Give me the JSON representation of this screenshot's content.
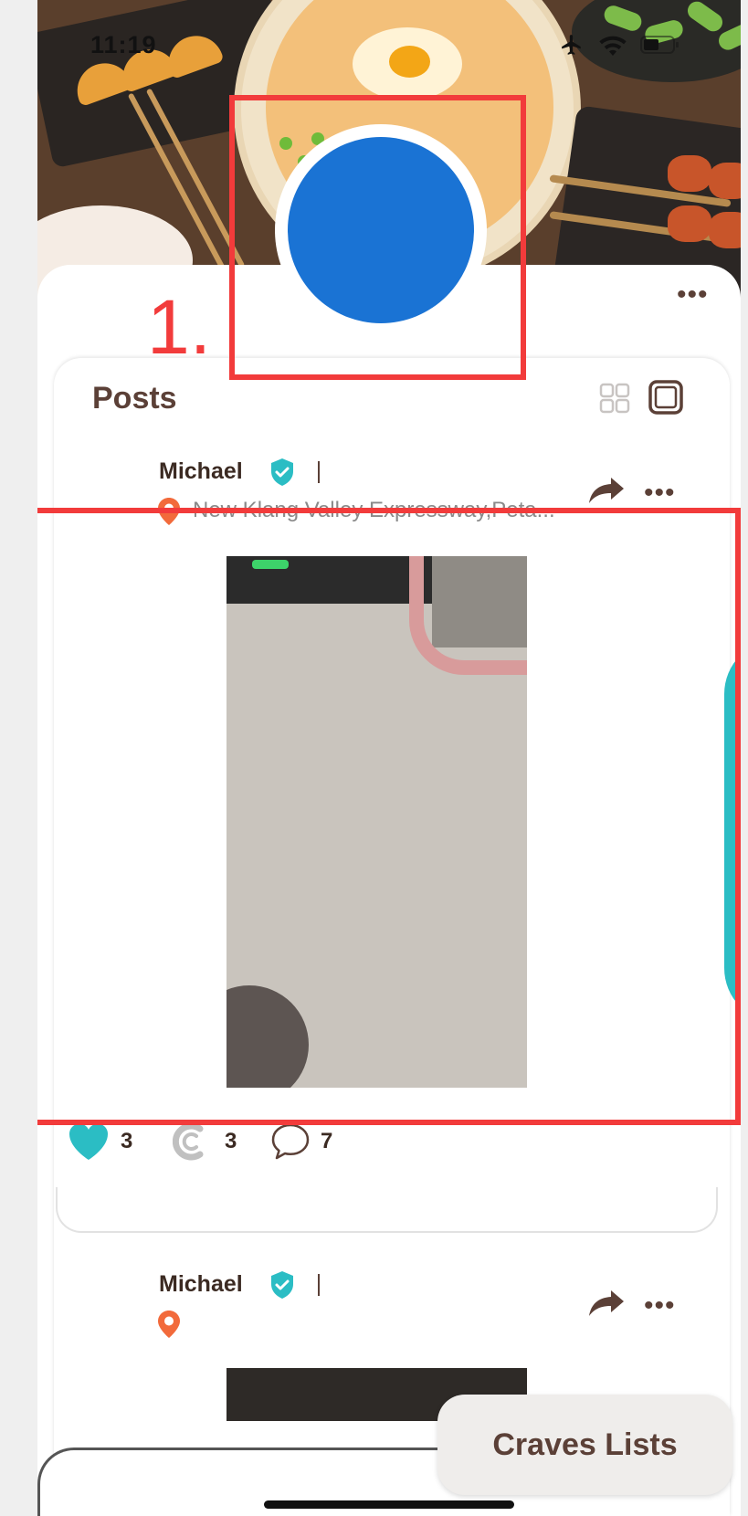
{
  "status_bar": {
    "time": "11:19",
    "icons": [
      "airplane-icon",
      "wifi-icon",
      "battery-icon"
    ]
  },
  "annotation": {
    "label": "1.",
    "color": "#f23b3b"
  },
  "profile": {
    "avatar_color": "#1a73d4",
    "more_icon": "more-icon"
  },
  "posts_section": {
    "title": "Posts",
    "view_icons": [
      "grid-view-icon",
      "single-view-icon"
    ]
  },
  "posts": [
    {
      "author": "Michael",
      "location": "New Klang Valley Expressway,Peta...",
      "likes": "3",
      "craves": "3",
      "comments": "7"
    },
    {
      "author": "Michael",
      "location": ""
    }
  ],
  "craves_lists_button": "Craves Lists",
  "colors": {
    "brand_brown": "#5b4037",
    "teal": "#2bbdc4",
    "orange_pin": "#f26a3b"
  }
}
